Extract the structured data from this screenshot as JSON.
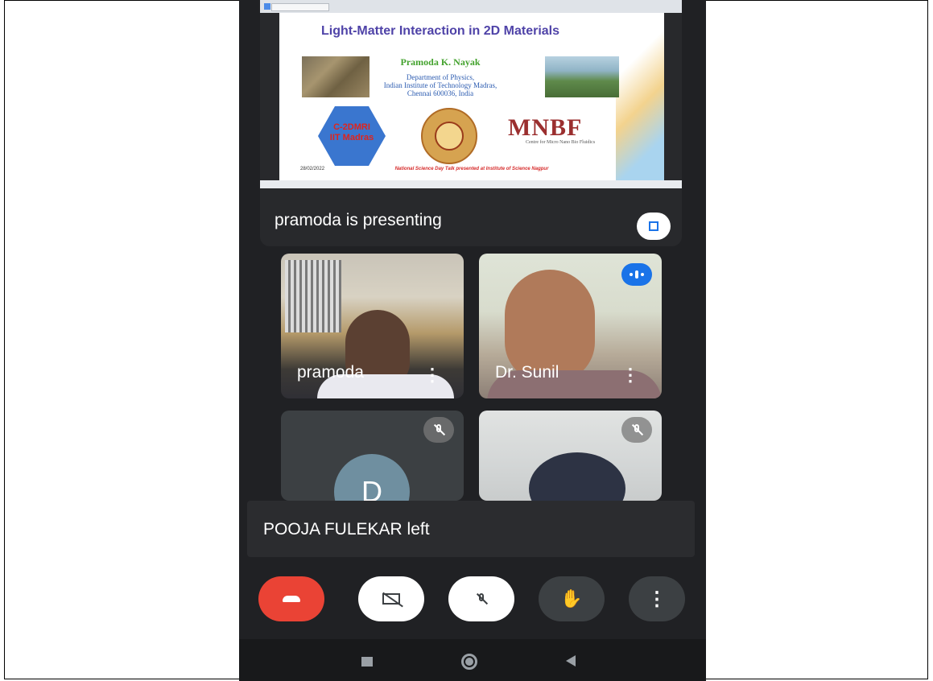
{
  "slide": {
    "title": "Light-Matter Interaction in 2D Materials",
    "author": "Pramoda K. Nayak",
    "dept_line1": "Department of Physics,",
    "dept_line2": "Indian Institute of Technology Madras,",
    "dept_line3": "Chennai 600036, India",
    "logo1_line1": "C-2DMRI",
    "logo1_line2": "IIT Madras",
    "logo3_text": "MNBF",
    "logo3_subtitle": "Centre for Micro Nano Bio Fluidics",
    "date": "28/02/2022",
    "footer": "National Science Day Talk presented at Institute of Science Nagpur"
  },
  "presenting": {
    "text": "pramoda is presenting",
    "fullscreen_icon": "fullscreen-icon"
  },
  "participants": [
    {
      "name": "pramoda"
    },
    {
      "name": "Dr. Sunil",
      "status": "speaking"
    },
    {
      "name": "",
      "avatar_letter": "D",
      "status": "muted"
    },
    {
      "name": "",
      "status": "muted"
    }
  ],
  "toast": {
    "text": "POOJA FULEKAR left"
  },
  "controls": {
    "leave_color": "#ea4335",
    "icons": [
      "phone-hangup-icon",
      "camera-off-icon",
      "mic-off-icon",
      "raise-hand-icon",
      "more-options-icon"
    ],
    "hand_glyph": "✋",
    "more_glyph": "⋮"
  },
  "tile_menu_glyph": "⋮",
  "colors": {
    "background": "#202124",
    "accent": "#1a73e8",
    "danger": "#ea4335"
  }
}
